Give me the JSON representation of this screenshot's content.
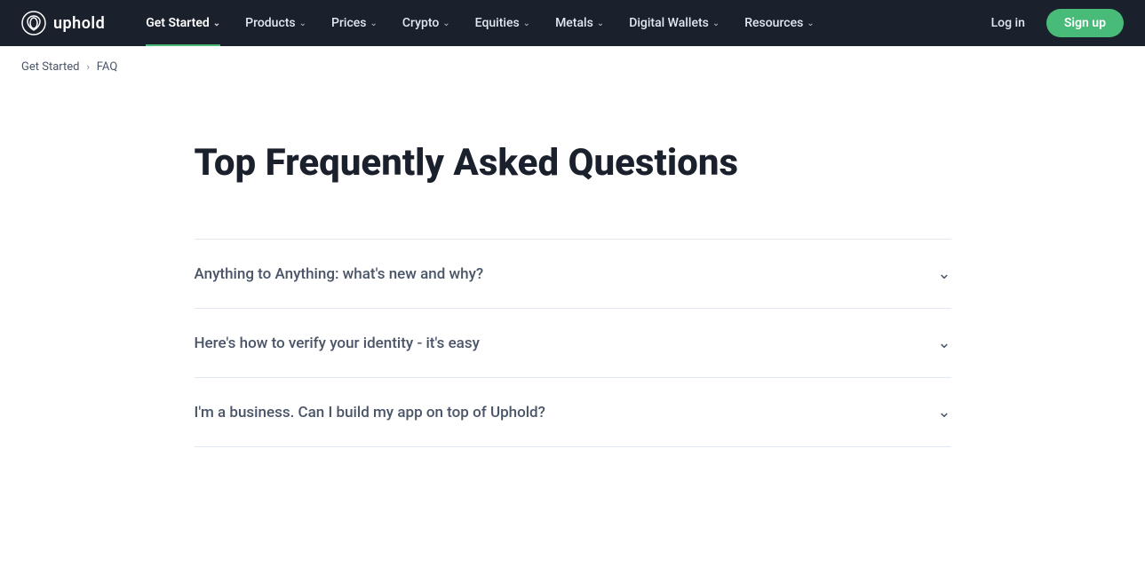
{
  "brand": {
    "logo_text": "uphold",
    "logo_alt": "uphold logo"
  },
  "navbar": {
    "items": [
      {
        "label": "Get Started",
        "active": true,
        "id": "get-started"
      },
      {
        "label": "Products",
        "active": false,
        "id": "products"
      },
      {
        "label": "Prices",
        "active": false,
        "id": "prices"
      },
      {
        "label": "Crypto",
        "active": false,
        "id": "crypto"
      },
      {
        "label": "Equities",
        "active": false,
        "id": "equities"
      },
      {
        "label": "Metals",
        "active": false,
        "id": "metals"
      },
      {
        "label": "Digital Wallets",
        "active": false,
        "id": "digital-wallets"
      },
      {
        "label": "Resources",
        "active": false,
        "id": "resources"
      }
    ],
    "login_label": "Log in",
    "signup_label": "Sign up"
  },
  "breadcrumb": {
    "parent_label": "Get Started",
    "current_label": "FAQ",
    "separator": "›"
  },
  "page": {
    "title": "Top Frequently Asked Questions"
  },
  "faq": {
    "items": [
      {
        "question": "Anything to Anything: what's new and why?",
        "id": "q1"
      },
      {
        "question": "Here's how to verify your identity - it's easy",
        "id": "q2"
      },
      {
        "question": "I'm a business. Can I build my app on top of Uphold?",
        "id": "q3"
      }
    ]
  },
  "icons": {
    "chevron_down": "∨",
    "breadcrumb_arrow": "›"
  }
}
